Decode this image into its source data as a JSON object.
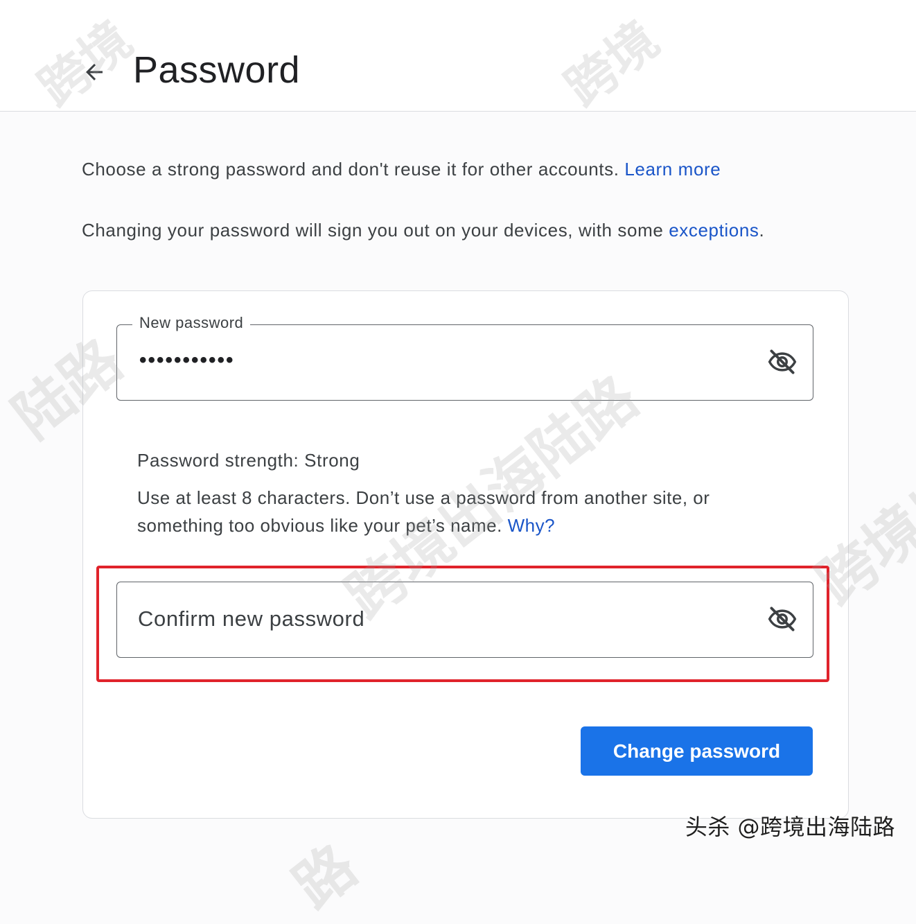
{
  "header": {
    "title": "Password",
    "back_icon": "arrow-left-icon"
  },
  "description": {
    "line1_text": "Choose a strong password and don't reuse it for other accounts.",
    "line1_link": "Learn more",
    "line2_text": "Changing your password will sign you out on your devices, with some",
    "line2_link": "exceptions",
    "line2_suffix": "."
  },
  "form": {
    "new_password": {
      "label": "New password",
      "value": "•••••••••••",
      "toggle_icon": "eye-off-icon"
    },
    "strength": {
      "label": "Password strength: Strong"
    },
    "hint": {
      "text": "Use at least 8 characters. Don’t use a password from another site, or something too obvious like your pet’s name.",
      "link": "Why?"
    },
    "confirm_password": {
      "placeholder": "Confirm new password",
      "toggle_icon": "eye-off-icon"
    },
    "submit_label": "Change password"
  },
  "colors": {
    "primary": "#1a73e8",
    "link": "#1a55c8",
    "highlight": "#e0232b"
  },
  "watermark": {
    "text1": "跨境",
    "text2": "跨境",
    "text3": "陆路",
    "text4": "跨境出海陆路",
    "text5": "跨境出",
    "text6": "路",
    "credit": "头杀 @跨境出海陆路"
  }
}
